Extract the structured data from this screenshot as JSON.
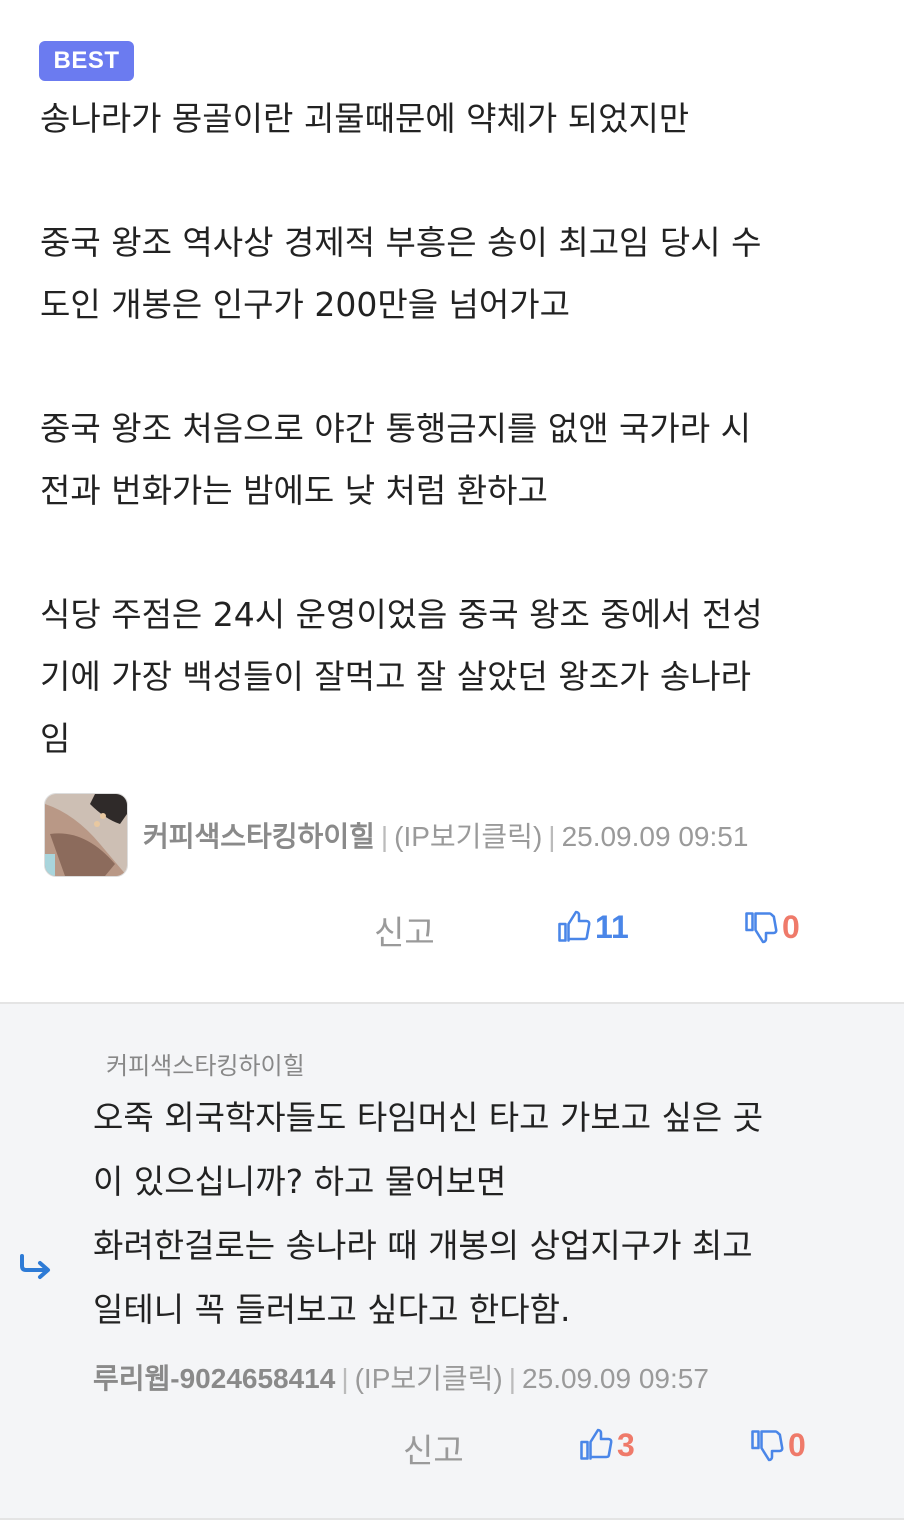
{
  "best_comment": {
    "badge": "BEST",
    "paragraphs": [
      [
        "송나라가 몽골이란 괴물때문에 약체가 되었지만"
      ],
      [
        "중국 왕조 역사상 경제적 부흥은 송이 최고임 당시 수",
        "도인 개봉은 인구가 200만을 넘어가고"
      ],
      [
        "중국 왕조 처음으로 야간 통행금지를 없앤 국가라 시",
        "전과 번화가는 밤에도 낮 처럼 환하고"
      ],
      [
        "식당 주점은 24시 운영이었음 중국 왕조 중에서 전성",
        "기에 가장 백성들이 잘먹고 잘 살았던 왕조가 송나라",
        "임"
      ]
    ],
    "author": "커피색스타킹하이힐",
    "ip": "(IP보기클릭)",
    "timestamp": "25.09.09 09:51",
    "report_label": "신고",
    "upvotes": "11",
    "downvotes": "0"
  },
  "reply": {
    "reply_to": "커피색스타킹하이힐",
    "lines": [
      "오죽 외국학자들도 타임머신 타고 가보고 싶은 곳",
      "이 있으십니까? 하고 물어보면",
      "화려한걸로는 송나라 때 개봉의 상업지구가 최고",
      "일테니 꼭 들러보고 싶다고 한다함."
    ],
    "author": "루리웹-9024658414",
    "ip": "(IP보기클릭)",
    "timestamp": "25.09.09 09:57",
    "report_label": "신고",
    "upvotes": "3",
    "downvotes": "0"
  },
  "colors": {
    "badge": "#6b7bf0",
    "upvote": "#4a86e8",
    "downvote": "#ef7a6a",
    "reply_bg": "#f4f5f7"
  },
  "icons": {
    "thumbs_up": "thumbs-up-icon",
    "thumbs_down": "thumbs-down-icon",
    "reply_arrow": "reply-arrow-icon"
  }
}
